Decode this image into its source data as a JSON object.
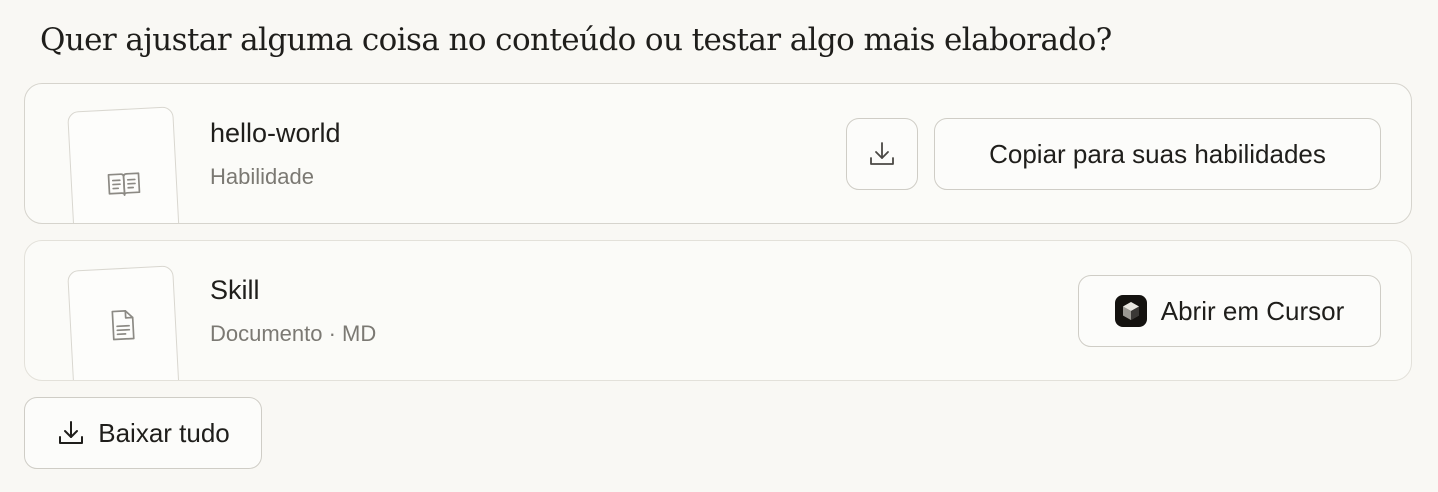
{
  "question": "Quer ajustar alguma coisa no conteúdo ou testar algo mais elaborado?",
  "files": [
    {
      "title": "hello-world",
      "subtitle": "Habilidade",
      "icon": "book-open-icon",
      "download_icon": "download-icon",
      "action_label": "Copiar para suas habilidades"
    },
    {
      "title": "Skill",
      "subtitle": "Documento · MD",
      "icon": "document-icon",
      "action_icon": "cursor-logo-icon",
      "action_label": "Abrir em Cursor"
    }
  ],
  "download_all": {
    "icon": "download-icon",
    "label": "Baixar tudo"
  },
  "colors": {
    "background": "#f9f8f4",
    "card_border": "#d6d4cd",
    "text_primary": "#1f1e1b",
    "text_secondary": "#7b7973"
  }
}
